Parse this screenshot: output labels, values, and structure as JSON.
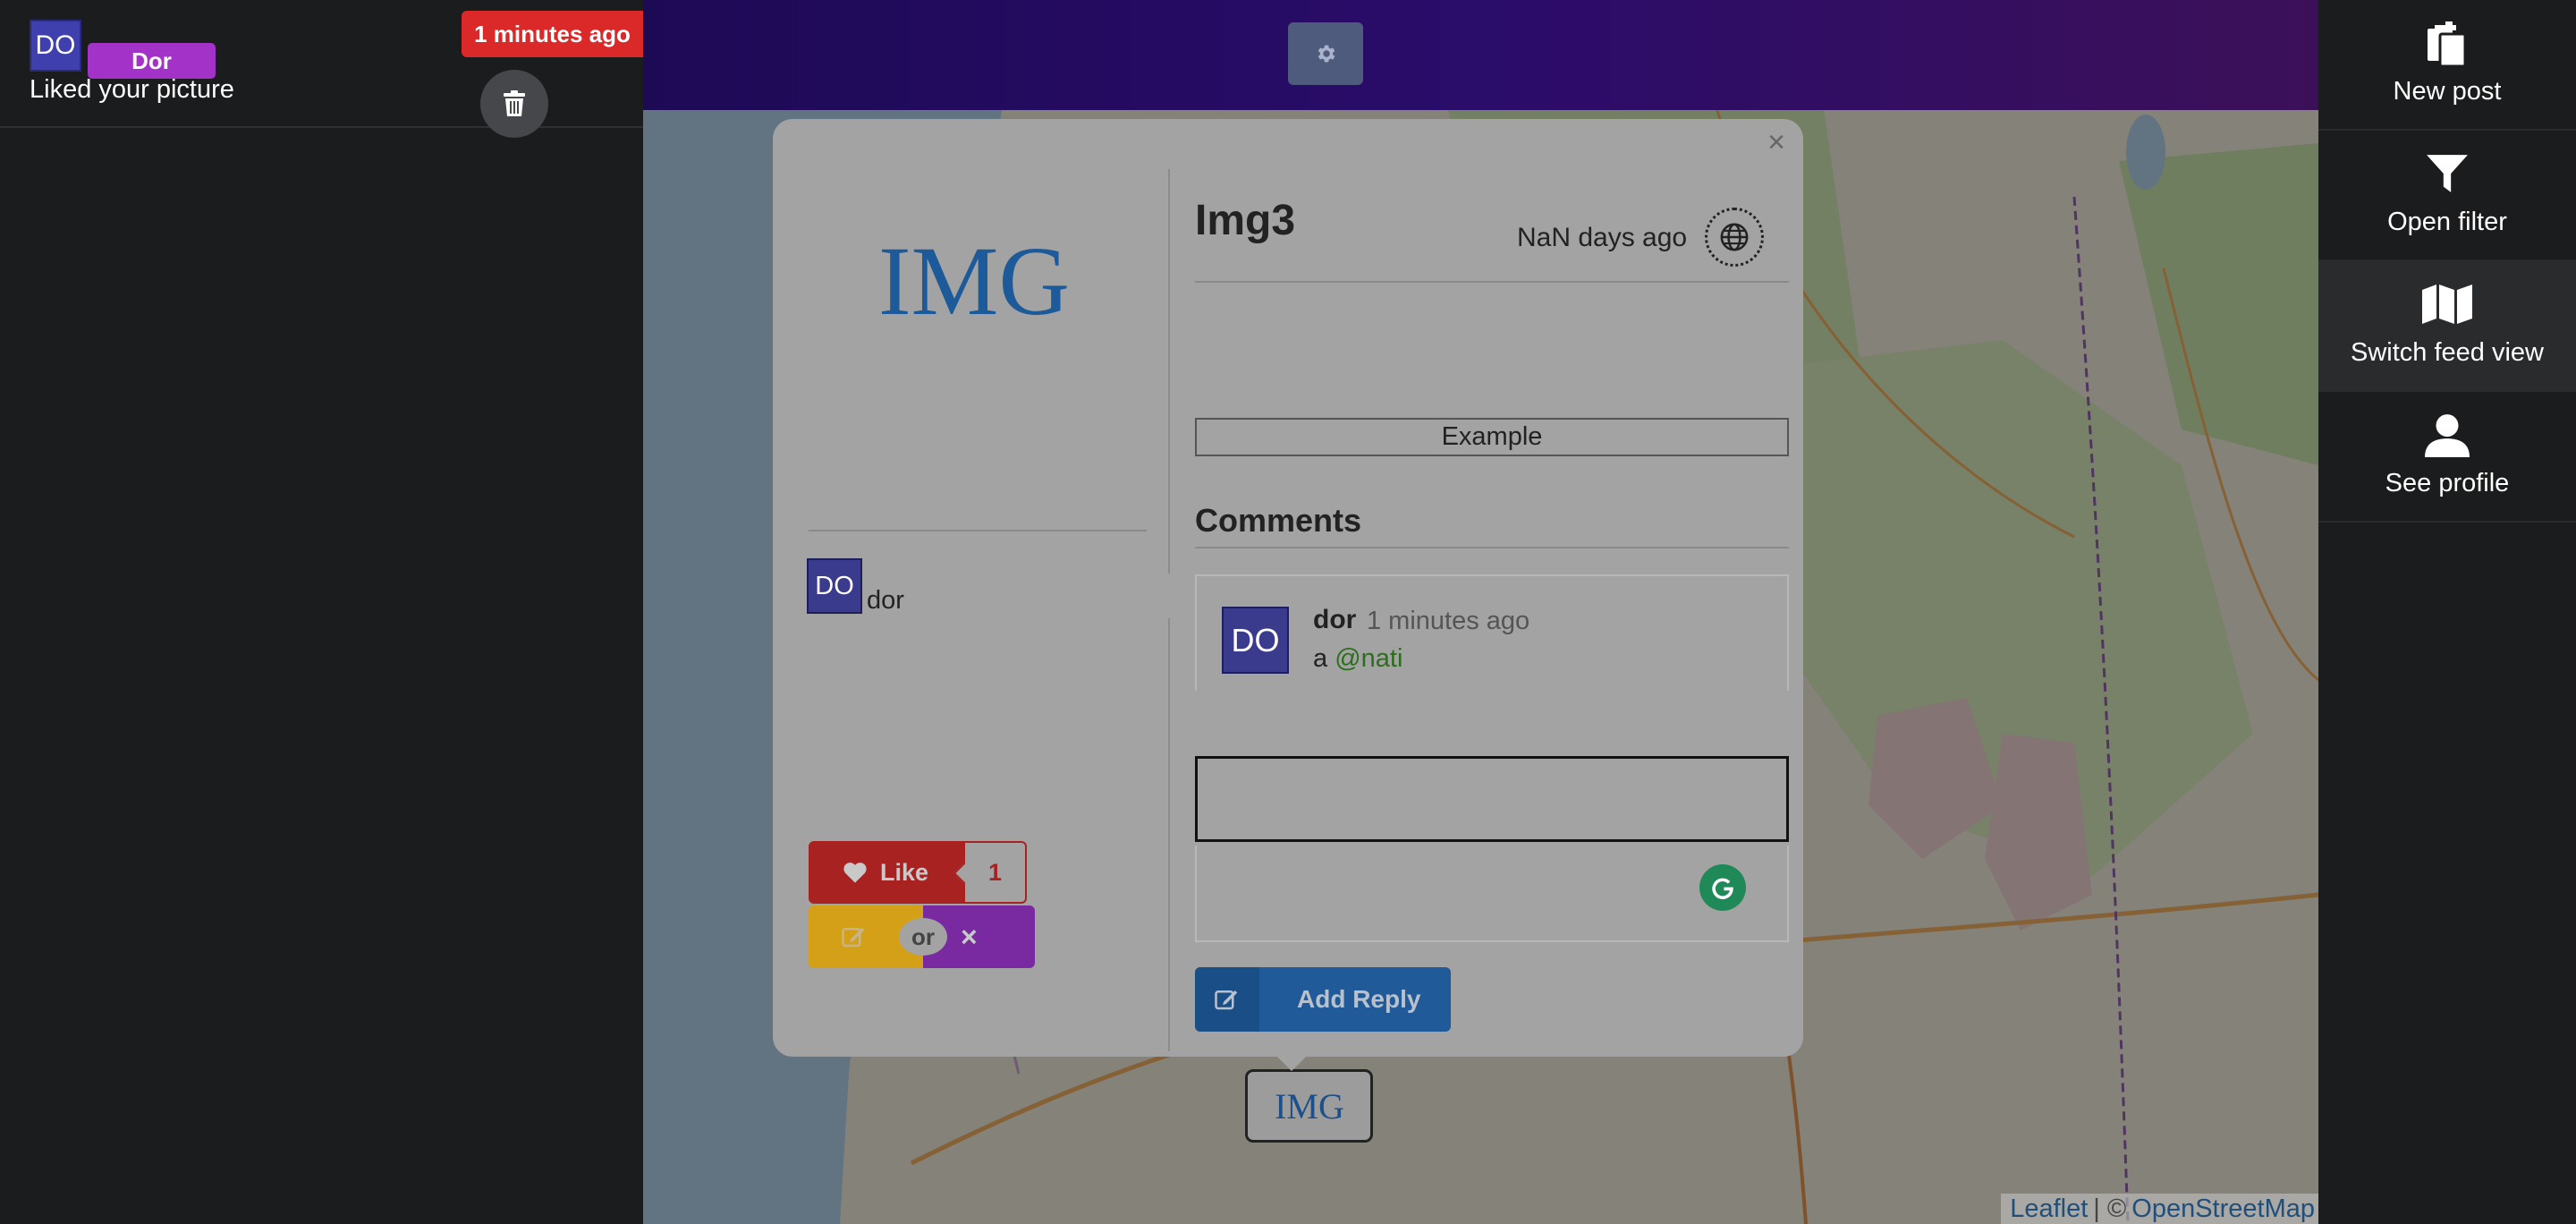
{
  "notification": {
    "avatar_initials": "DO",
    "user_label": "Dor",
    "message": "Liked your picture",
    "time": "1 minutes ago",
    "delete_icon": "trash-icon"
  },
  "top_bar": {
    "settings_icon": "gear-icon"
  },
  "map": {
    "attribution_leaflet": "Leaflet",
    "attribution_separator": "| ©",
    "attribution_osm": "OpenStreetMap",
    "marker_logo": "IMG"
  },
  "post": {
    "image_logo": "IMG",
    "title": "Img3",
    "date": "NaN days ago",
    "visibility_icon": "globe-icon",
    "tag": "Example",
    "author_initials": "DO",
    "author_name": "dor",
    "like_label": "Like",
    "like_count": "1",
    "or_label": "or",
    "close_symbol": "×"
  },
  "comments": {
    "title": "Comments",
    "items": [
      {
        "avatar_initials": "DO",
        "author": "dor",
        "time": "1 minutes ago",
        "text": "a",
        "mention": "@nati"
      }
    ],
    "reply_button_label": "Add Reply"
  },
  "sidebar": {
    "items": [
      {
        "label": "New post",
        "icon": "copy-icon"
      },
      {
        "label": "Open filter",
        "icon": "filter-icon"
      },
      {
        "label": "Switch feed view",
        "icon": "map-icon"
      },
      {
        "label": "See profile",
        "icon": "user-icon"
      }
    ]
  },
  "colors": {
    "accent_red": "#db2828",
    "accent_purple": "#a333c8",
    "like_red": "#a82222",
    "edit_yellow": "#d4a017",
    "delete_purple": "#7a2aa0",
    "reply_blue": "#205a99",
    "mention_green": "#2c6e1e"
  }
}
